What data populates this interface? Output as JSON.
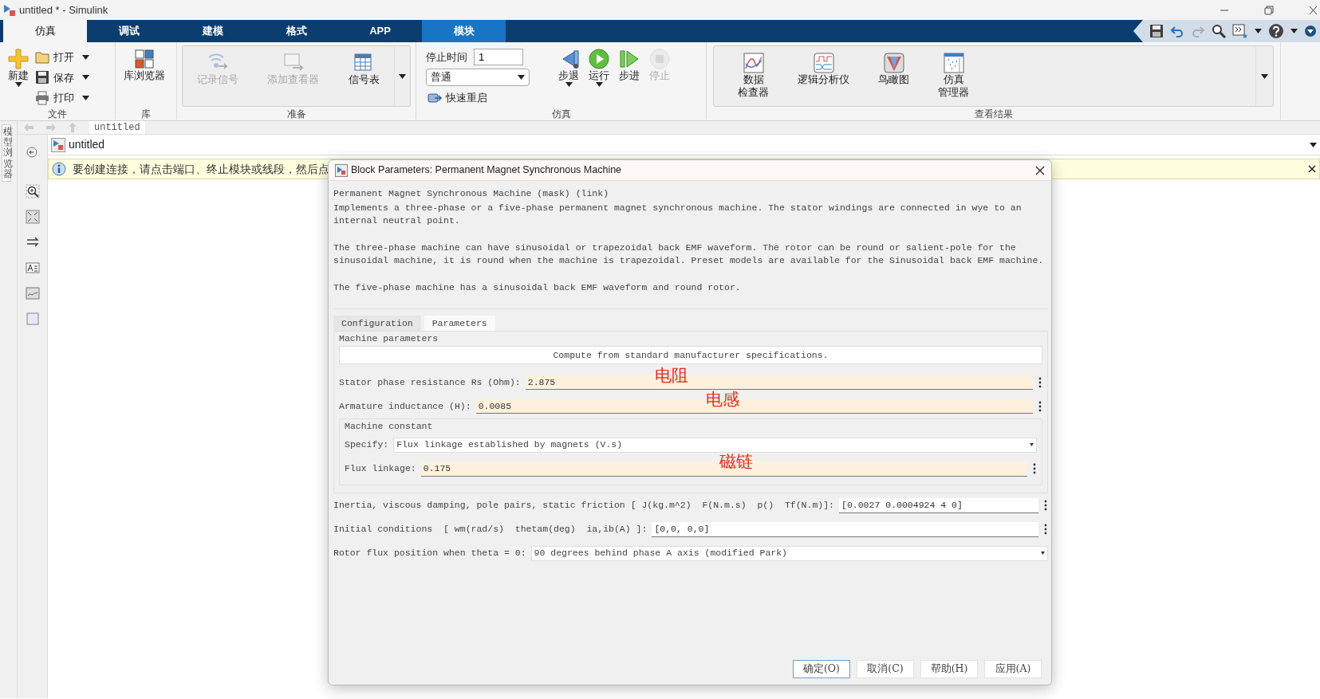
{
  "window": {
    "title": "untitled * - Simulink"
  },
  "ribbon_tabs": [
    {
      "label": "仿真",
      "selected": true,
      "contextual": false
    },
    {
      "label": "调试",
      "selected": false,
      "contextual": false
    },
    {
      "label": "建模",
      "selected": false,
      "contextual": false
    },
    {
      "label": "格式",
      "selected": false,
      "contextual": false
    },
    {
      "label": "APP",
      "selected": false,
      "contextual": false
    },
    {
      "label": "模块",
      "selected": false,
      "contextual": true
    }
  ],
  "ribbon": {
    "file": {
      "label": "文件",
      "buttons": [
        {
          "label": "新建",
          "disabled": false
        },
        {
          "label": "打开",
          "disabled": false
        },
        {
          "label": "保存",
          "disabled": false
        },
        {
          "label": "打印",
          "disabled": false
        }
      ]
    },
    "library": {
      "label": "库",
      "buttons": [
        {
          "label": "库浏览器",
          "disabled": false
        }
      ]
    },
    "prepare": {
      "label": "准备",
      "buttons": [
        {
          "label": "记录信号",
          "disabled": true
        },
        {
          "label": "添加查看器",
          "disabled": true
        },
        {
          "label": "信号表",
          "disabled": false
        }
      ]
    },
    "simulate": {
      "label": "仿真",
      "stop_time": {
        "label": "停止时间",
        "value": "1"
      },
      "mode": {
        "value": "普通"
      },
      "fast_restart": {
        "label": "快速重启"
      },
      "buttons": [
        {
          "label": "步退",
          "disabled": false
        },
        {
          "label": "运行",
          "disabled": false
        },
        {
          "label": "步进",
          "disabled": false
        },
        {
          "label": "停止",
          "disabled": true
        }
      ]
    },
    "review": {
      "label": "查看结果",
      "buttons": [
        {
          "lines": [
            "数据",
            "检查器"
          ],
          "disabled": false
        },
        {
          "lines": [
            "逻辑分析仪"
          ],
          "disabled": false
        },
        {
          "lines": [
            "鸟瞰图"
          ],
          "disabled": false
        },
        {
          "lines": [
            "仿真",
            "管理器"
          ],
          "disabled": false
        }
      ]
    }
  },
  "side_tab": {
    "label": "模型浏览器"
  },
  "breadcrumb": {
    "path": "untitled"
  },
  "address_bar": {
    "model": "untitled"
  },
  "info_bar": {
    "message": "要创建连接，请点击端口、终止模块或线段，然后点"
  },
  "dialog": {
    "title": "Block Parameters: Permanent Magnet Synchronous Machine",
    "heading": "Permanent Magnet Synchronous Machine (mask) (link)",
    "description": [
      "Implements a three-phase or a five-phase permanent magnet synchronous machine. The stator windings are connected in wye to an internal neutral point.",
      "The three-phase machine can have sinusoidal or trapezoidal back EMF waveform. The rotor can be round or salient-pole for the sinusoidal machine, it is round when the machine is trapezoidal. Preset models are available for the Sinusoidal back EMF machine.",
      "The five-phase machine has a sinusoidal back EMF waveform and round rotor."
    ],
    "tabs": [
      {
        "label": "Configuration",
        "selected": false
      },
      {
        "label": "Parameters",
        "selected": true
      }
    ],
    "group_title": "Machine parameters",
    "compute_button": "Compute from standard manufacturer specifications.",
    "fields": [
      {
        "kind": "edit",
        "label": "Stator phase resistance Rs (Ohm):",
        "value": "2.875",
        "highlighted": true,
        "note": "电阻"
      },
      {
        "kind": "edit",
        "label": "Armature inductance (H):",
        "value": "0.0085",
        "highlighted": true,
        "note": "电感"
      },
      {
        "kind": "group",
        "label": "Machine constant",
        "children": [
          {
            "kind": "popup",
            "label": "Specify:",
            "value": "Flux linkage established by magnets (V.s)"
          },
          {
            "kind": "edit",
            "label": "Flux linkage:",
            "value": "0.175",
            "highlighted": true,
            "note": "磁链"
          }
        ]
      },
      {
        "kind": "edit",
        "label": "Inertia, viscous damping, pole pairs, static friction [ J(kg.m^2)  F(N.m.s)  p()  Tf(N.m)]:",
        "value": "[0.0027 0.0004924 4 0]",
        "highlighted": false
      },
      {
        "kind": "edit",
        "label": "Initial conditions  [ wm(rad/s)  thetam(deg)  ia,ib(A) ]:",
        "value": "[0,0, 0,0]",
        "highlighted": false
      },
      {
        "kind": "popup",
        "label": "Rotor flux position when theta = 0:",
        "value": "90 degrees behind phase A axis (modified Park)"
      }
    ],
    "buttons": [
      {
        "label": "确定(O)",
        "default": true
      },
      {
        "label": "取消(C)",
        "default": false
      },
      {
        "label": "帮助(H)",
        "default": false
      },
      {
        "label": "应用(A)",
        "default": false
      }
    ]
  }
}
